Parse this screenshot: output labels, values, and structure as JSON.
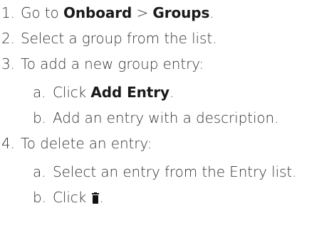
{
  "steps": [
    {
      "num": "1.",
      "pre": "Go to ",
      "b1": "Onboard",
      "mid": " > ",
      "b2": "Groups",
      "post": "."
    },
    {
      "num": "2.",
      "text": "Select a group from the list."
    },
    {
      "num": "3.",
      "text": "To add a new group entry:"
    },
    {
      "num": "a.",
      "pre": "Click ",
      "b1": "Add Entry",
      "post": "."
    },
    {
      "num": "b.",
      "text": "Add an entry with a description."
    },
    {
      "num": "4.",
      "text": "To delete an entry:"
    },
    {
      "num": "a.",
      "text": "Select an entry from the Entry list."
    },
    {
      "num": "b.",
      "pre": "Click ",
      "icon": "trash-icon",
      "post": "."
    }
  ]
}
